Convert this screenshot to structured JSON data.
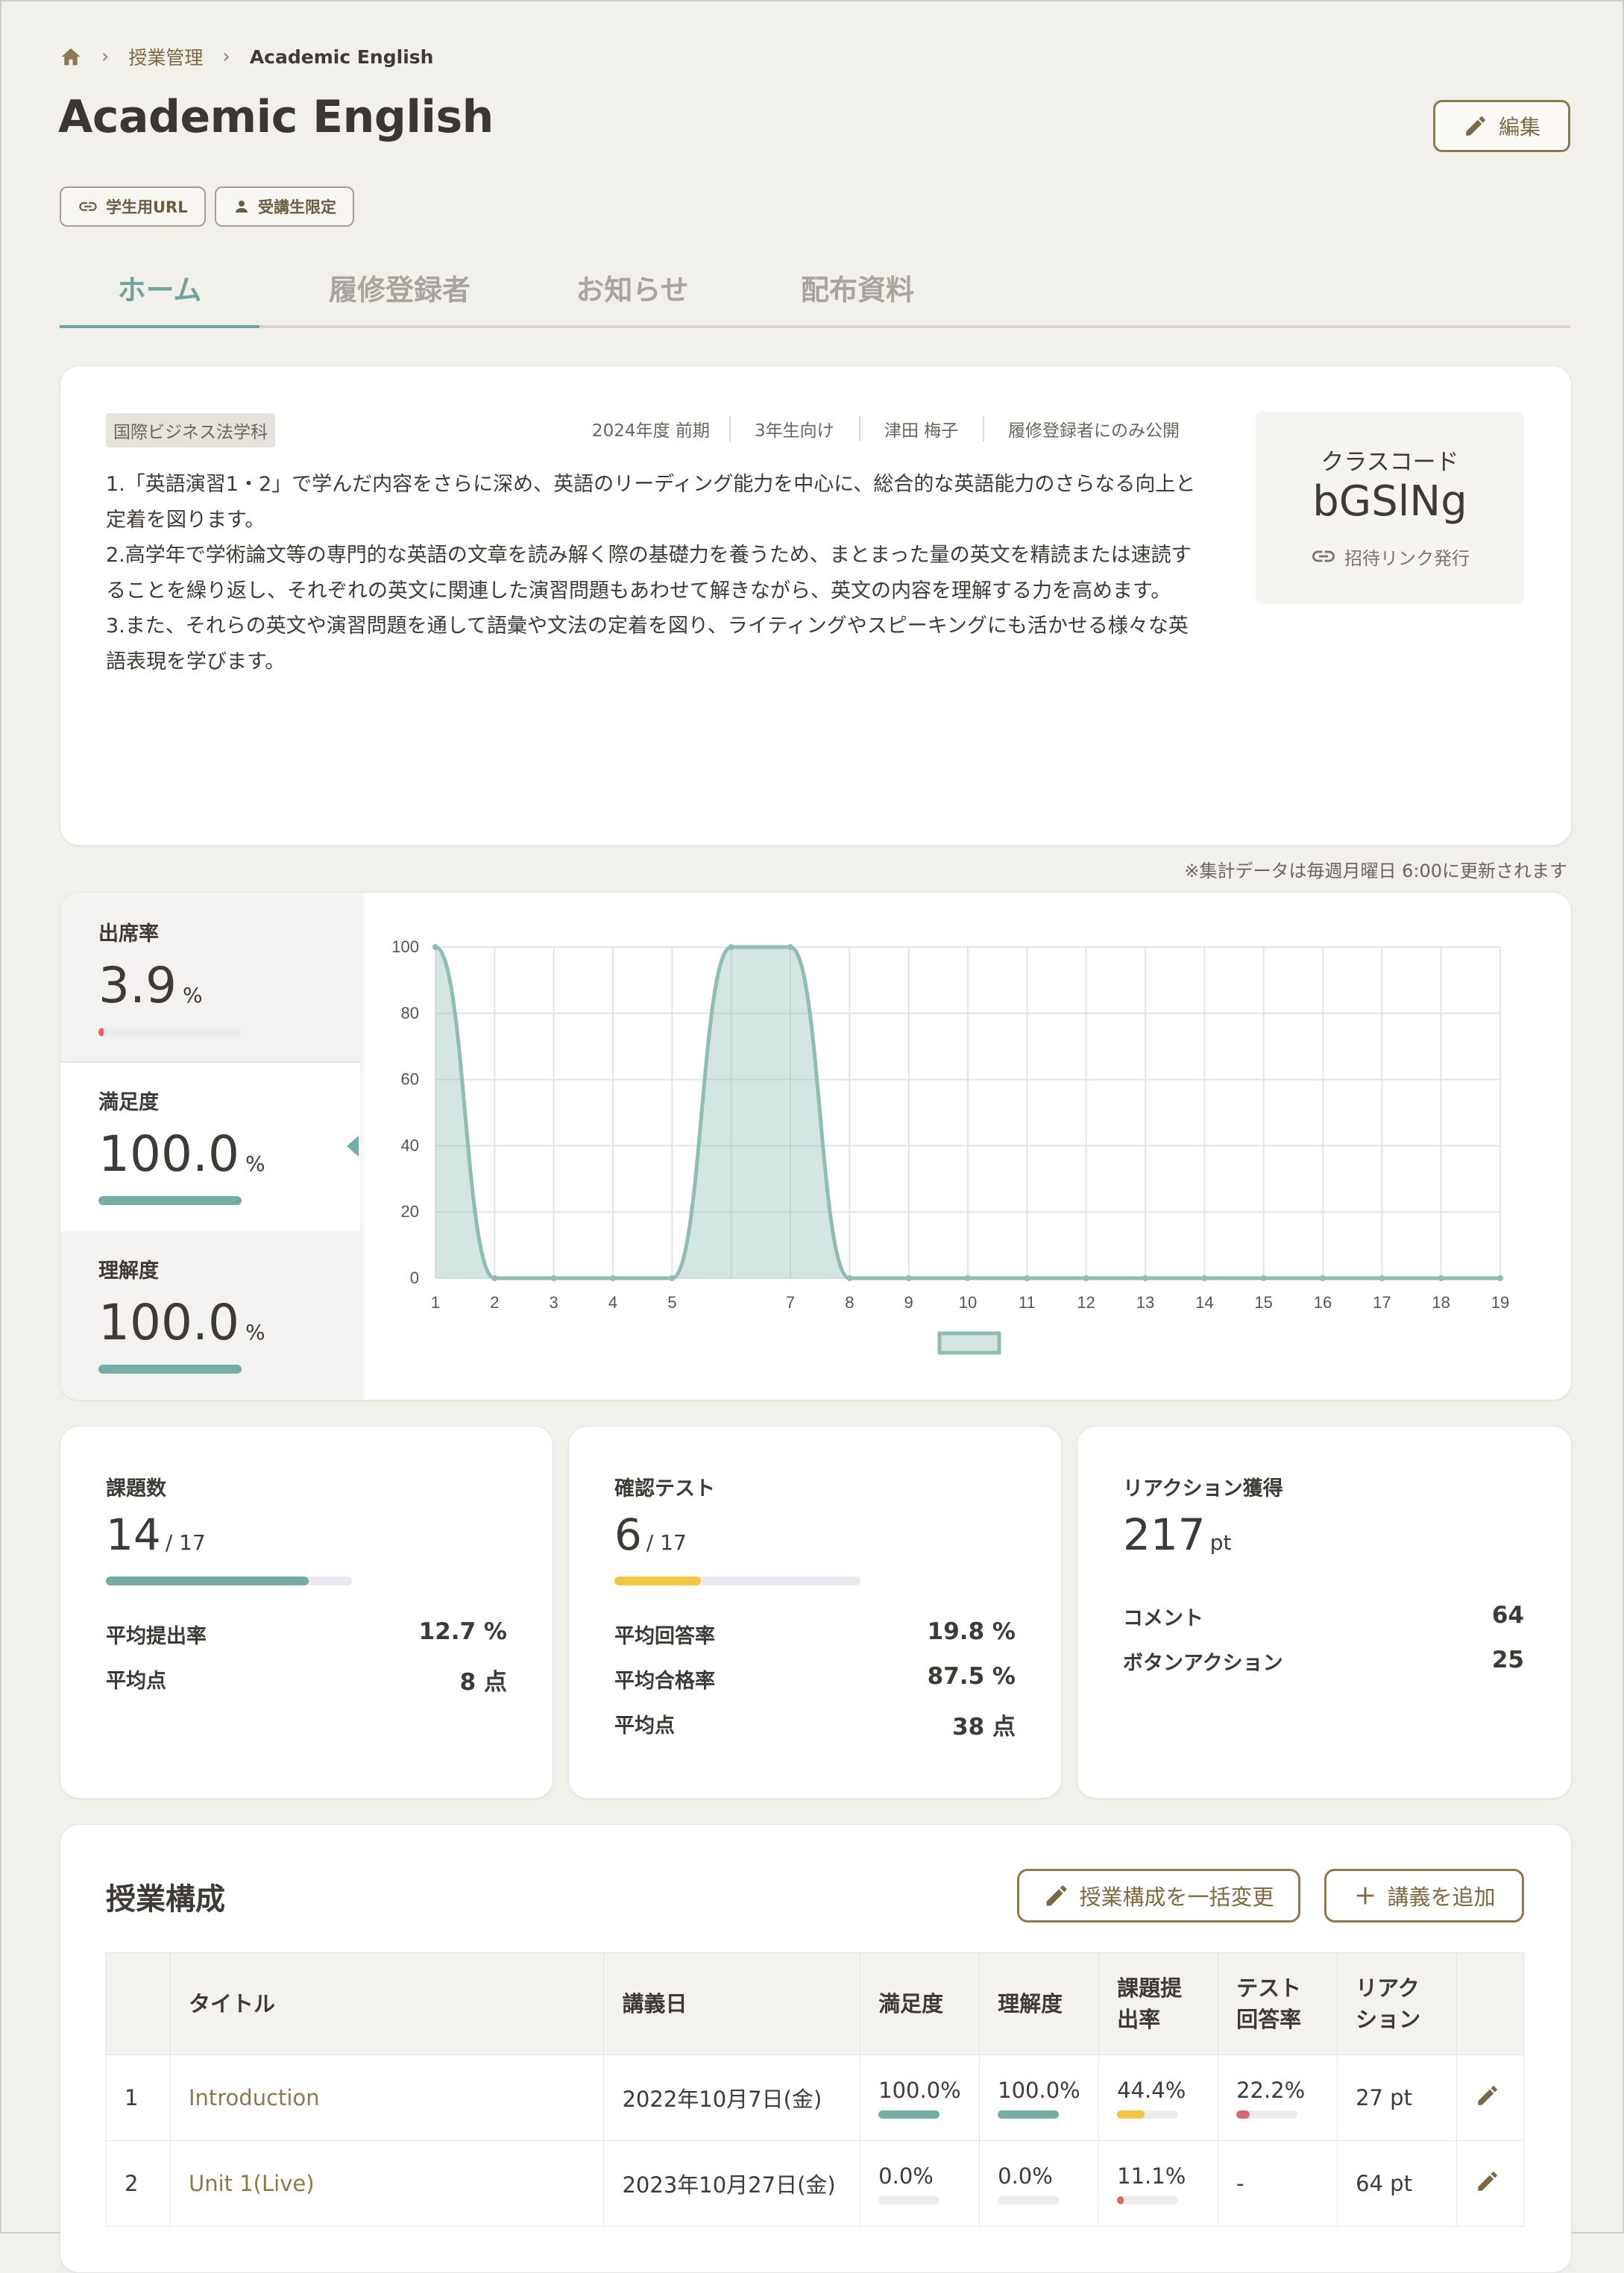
{
  "breadcrumb": {
    "level1": "授業管理",
    "current": "Academic English"
  },
  "page": {
    "title": "Academic English",
    "edit_label": "編集"
  },
  "chips": {
    "student_url": "学生用URL",
    "restricted": "受講生限定"
  },
  "tabs": [
    {
      "label": "ホーム"
    },
    {
      "label": "履修登録者"
    },
    {
      "label": "お知らせ"
    },
    {
      "label": "配布資料"
    }
  ],
  "course": {
    "department": "国際ビジネス法学科",
    "term": "2024年度 前期",
    "grade": "3年生向け",
    "teacher": "津田 梅子",
    "visibility": "履修登録者にのみ公開",
    "description": [
      "1.「英語演習1・2」で学んだ内容をさらに深め、英語のリーディング能力を中心に、総合的な英語能力のさらなる向上と定着を図ります。",
      "2.高学年で学術論文等の専門的な英語の文章を読み解く際の基礎力を養うため、まとまった量の英文を精読または速読することを繰り返し、それぞれの英文に関連した演習問題もあわせて解きながら、英文の内容を理解する力を高めます。",
      "3.また、それらの英文や演習問題を通して語彙や文法の定着を図り、ライティングやスピーキングにも活かせる様々な英語表現を学びます。"
    ],
    "class_code_label": "クラスコード",
    "class_code": "bGSlNg",
    "invite_label": "招待リンク発行"
  },
  "notice": "※集計データは毎週月曜日 6:00に更新されます",
  "metrics": [
    {
      "label": "出席率",
      "value": "3.9",
      "unit": "%",
      "level": 0.039,
      "color": "#e06666"
    },
    {
      "label": "満足度",
      "value": "100.0",
      "unit": "%",
      "level": 1.0,
      "color": "#74aca6"
    },
    {
      "label": "理解度",
      "value": "100.0",
      "unit": "%",
      "level": 1.0,
      "color": "#74aca6"
    }
  ],
  "chart_data": {
    "type": "area",
    "x": [
      1,
      2,
      3,
      4,
      5,
      6,
      7,
      8,
      9,
      10,
      11,
      12,
      13,
      14,
      15,
      16,
      17,
      18,
      19
    ],
    "series": [
      {
        "values": [
          100,
          0,
          0,
          0,
          0,
          100,
          100,
          0,
          0,
          0,
          0,
          0,
          0,
          0,
          0,
          0,
          0,
          0,
          0
        ]
      }
    ],
    "x_ticks": [
      "1",
      "2",
      "3",
      "4",
      "5",
      "7",
      "8",
      "9",
      "10",
      "11",
      "12",
      "13",
      "14",
      "15",
      "16",
      "17",
      "18",
      "19"
    ],
    "y_ticks": [
      "0",
      "20",
      "40",
      "60",
      "80",
      "100"
    ],
    "ylim": [
      0,
      100
    ],
    "grid": true,
    "color": "#8fbdb3"
  },
  "assignments": {
    "title": "課題数",
    "count": "14",
    "total": "/ 17",
    "level": 0.8235,
    "color": "#74aca6",
    "rows": [
      {
        "label": "平均提出率",
        "value": "12.7 %"
      },
      {
        "label": "平均点",
        "value": "8 点"
      }
    ]
  },
  "tests": {
    "title": "確認テスト",
    "count": "6",
    "total": "/ 17",
    "level": 0.353,
    "color": "#f4c542",
    "rows": [
      {
        "label": "平均回答率",
        "value": "19.8 %"
      },
      {
        "label": "平均合格率",
        "value": "87.5 %"
      },
      {
        "label": "平均点",
        "value": "38 点"
      }
    ]
  },
  "reactions": {
    "title": "リアクション獲得",
    "count": "217",
    "unit": "pt",
    "rows": [
      {
        "label": "コメント",
        "value": "64"
      },
      {
        "label": "ボタンアクション",
        "value": "25"
      }
    ]
  },
  "lessons": {
    "title": "授業構成",
    "bulk_edit_label": "授業構成を一括変更",
    "add_label": "講義を追加",
    "headers": [
      "タイトル",
      "講義日",
      "満足度",
      "理解度",
      "課題提出率",
      "テスト回答率",
      "リアクション"
    ],
    "headers_lines": [
      [
        "課題提",
        "出率"
      ],
      [
        "テスト",
        "回答率"
      ],
      [
        "リアク",
        "ション"
      ]
    ],
    "rows": [
      {
        "no": "1",
        "title": "Introduction",
        "date": "2022年10月7日(金)",
        "satisfaction": "100.0%",
        "sat_level": 1.0,
        "understanding": "100.0%",
        "und_level": 1.0,
        "submission": "44.4%",
        "sub_level": 0.444,
        "test": "22.2%",
        "test_level": 0.222,
        "reaction": "27 pt"
      },
      {
        "no": "2",
        "title": "Unit 1(Live)",
        "date": "2023年10月27日(金)",
        "satisfaction": "0.0%",
        "sat_level": 0.0,
        "understanding": "0.0%",
        "und_level": 0.0,
        "submission": "11.1%",
        "sub_level": 0.111,
        "test": "-",
        "test_level": null,
        "reaction": "64 pt"
      }
    ]
  }
}
